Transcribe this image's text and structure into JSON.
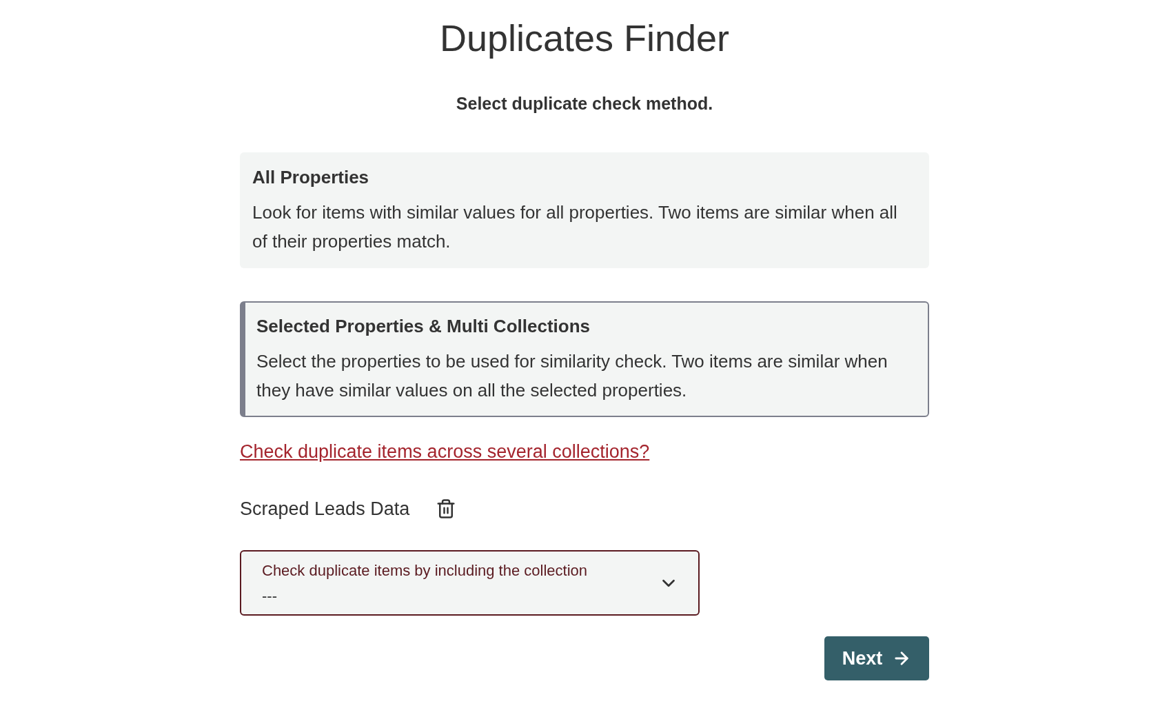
{
  "title": "Duplicates Finder",
  "prompt": "Select duplicate check method.",
  "methods": [
    {
      "title": "All Properties",
      "description": "Look for items with similar values for all properties. Two items are similar when all of their properties match.",
      "selected": false
    },
    {
      "title": "Selected Properties & Multi Collections",
      "description": "Select the properties to be used for similarity check. Two items are similar when they have similar values on all the selected properties.",
      "selected": true
    }
  ],
  "link": "Check duplicate items across several collections?",
  "collection": {
    "name": "Scraped Leads Data"
  },
  "select": {
    "label": "Check duplicate items by including the collection",
    "value": "---"
  },
  "next_button": "Next"
}
